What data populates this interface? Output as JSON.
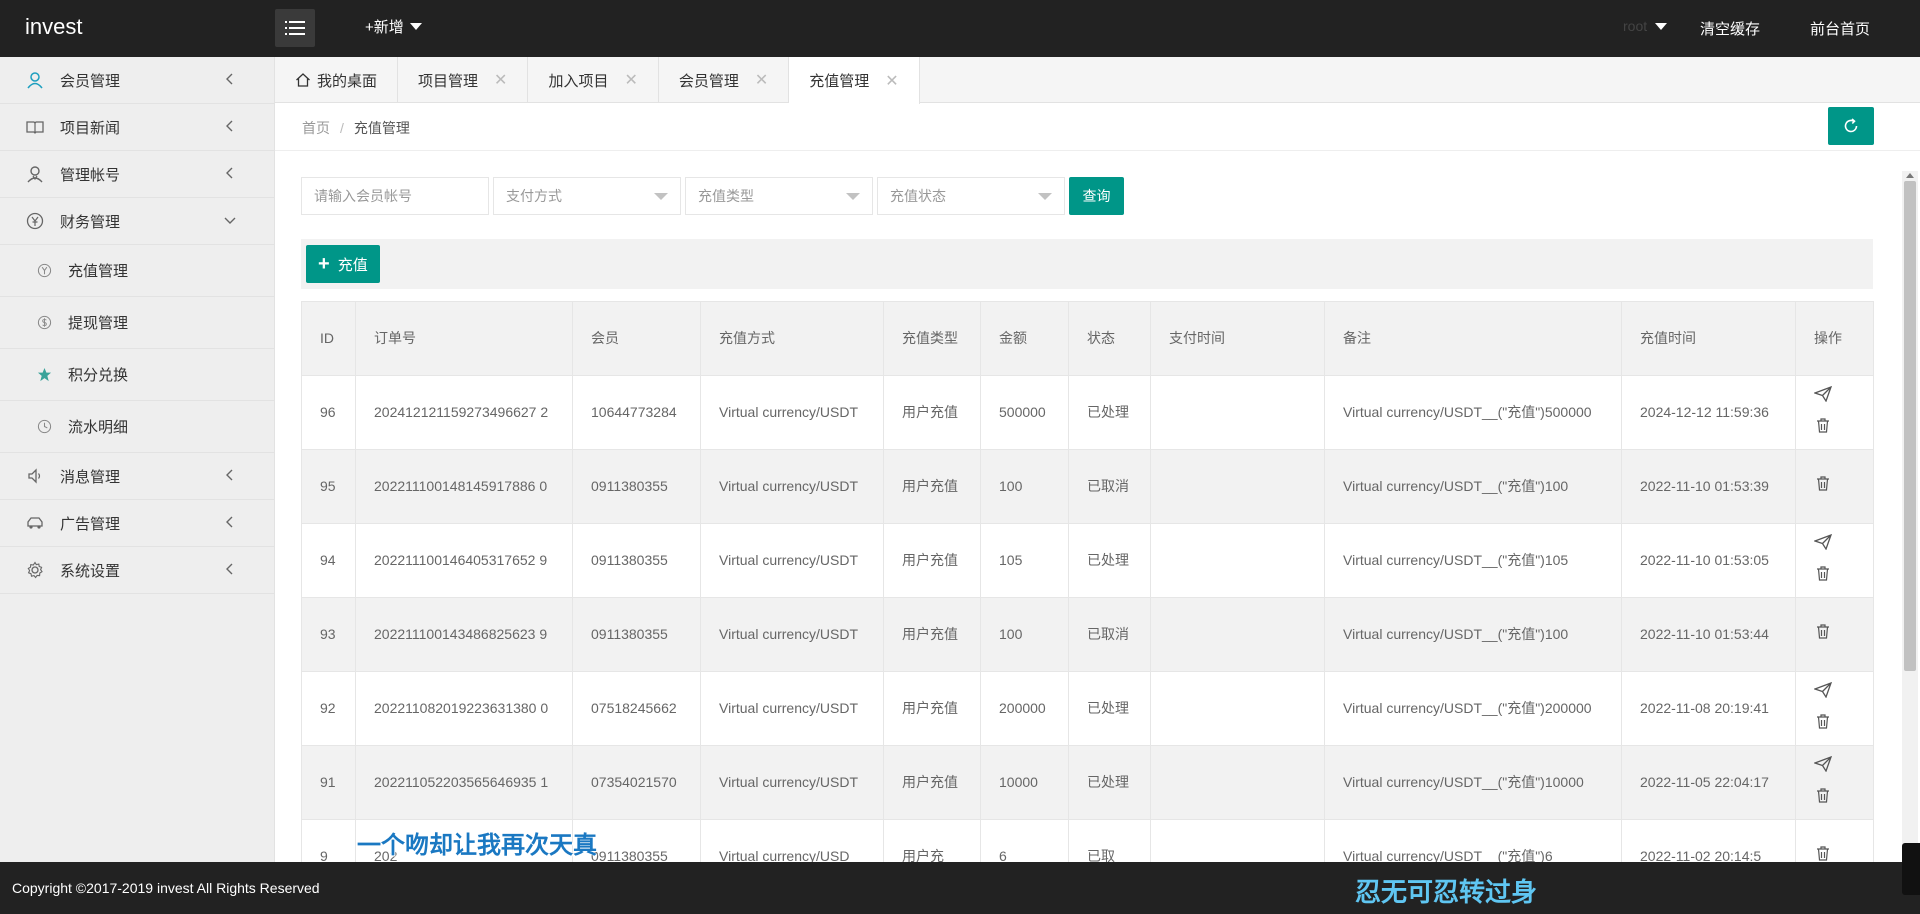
{
  "header": {
    "logo": "invest",
    "add_new": "+新增",
    "user": "root",
    "clear_cache": "清空缓存",
    "front_home": "前台首页"
  },
  "sidebar": {
    "items": [
      {
        "label": "会员管理",
        "icon": "user-icon"
      },
      {
        "label": "项目新闻",
        "icon": "book-icon"
      },
      {
        "label": "管理帐号",
        "icon": "admin-icon"
      },
      {
        "label": "财务管理",
        "icon": "yen-icon"
      },
      {
        "label": "消息管理",
        "icon": "speaker-icon"
      },
      {
        "label": "广告管理",
        "icon": "car-icon"
      },
      {
        "label": "系统设置",
        "icon": "gear-icon"
      }
    ],
    "finance_sub": [
      {
        "label": "充值管理",
        "icon": "yen-circle-icon"
      },
      {
        "label": "提现管理",
        "icon": "dollar-circle-icon"
      },
      {
        "label": "积分兑换",
        "icon": "star-icon"
      },
      {
        "label": "流水明细",
        "icon": "clock-icon"
      }
    ]
  },
  "tabs": [
    {
      "label": "我的桌面"
    },
    {
      "label": "项目管理"
    },
    {
      "label": "加入项目"
    },
    {
      "label": "会员管理"
    },
    {
      "label": "充值管理"
    }
  ],
  "breadcrumb": {
    "home": "首页",
    "sep": "/",
    "current": "充值管理"
  },
  "filter": {
    "member_placeholder": "请输入会员帐号",
    "pay_method": "支付方式",
    "recharge_type": "充值类型",
    "recharge_status": "充值状态",
    "query": "查询"
  },
  "toolbar": {
    "recharge": "充值"
  },
  "table": {
    "headers": [
      "ID",
      "订单号",
      "会员",
      "充值方式",
      "充值类型",
      "金额",
      "状态",
      "支付时间",
      "备注",
      "充值时间",
      "操作"
    ],
    "rows": [
      {
        "id": "96",
        "order": "202412121159273496627 2",
        "member": "10644773284",
        "method": "Virtual currency/USDT",
        "type": "用户充值",
        "amount": "500000",
        "status": "已处理",
        "pay_time": "",
        "note": "Virtual currency/USDT__(\"充值\")500000",
        "time": "2024-12-12 11:59:36",
        "ops": [
          "send",
          "delete"
        ]
      },
      {
        "id": "95",
        "order": "202211100148145917886 0",
        "member": "0911380355",
        "method": "Virtual currency/USDT",
        "type": "用户充值",
        "amount": "100",
        "status": "已取消",
        "pay_time": "",
        "note": "Virtual currency/USDT__(\"充值\")100",
        "time": "2022-11-10 01:53:39",
        "ops": [
          "delete"
        ]
      },
      {
        "id": "94",
        "order": "202211100146405317652 9",
        "member": "0911380355",
        "method": "Virtual currency/USDT",
        "type": "用户充值",
        "amount": "105",
        "status": "已处理",
        "pay_time": "",
        "note": "Virtual currency/USDT__(\"充值\")105",
        "time": "2022-11-10 01:53:05",
        "ops": [
          "send",
          "delete"
        ]
      },
      {
        "id": "93",
        "order": "202211100143486825623 9",
        "member": "0911380355",
        "method": "Virtual currency/USDT",
        "type": "用户充值",
        "amount": "100",
        "status": "已取消",
        "pay_time": "",
        "note": "Virtual currency/USDT__(\"充值\")100",
        "time": "2022-11-10 01:53:44",
        "ops": [
          "delete"
        ]
      },
      {
        "id": "92",
        "order": "202211082019223631380 0",
        "member": "07518245662",
        "method": "Virtual currency/USDT",
        "type": "用户充值",
        "amount": "200000",
        "status": "已处理",
        "pay_time": "",
        "note": "Virtual currency/USDT__(\"充值\")200000",
        "time": "2022-11-08 20:19:41",
        "ops": [
          "send",
          "delete"
        ]
      },
      {
        "id": "91",
        "order": "202211052203565646935 1",
        "member": "07354021570",
        "method": "Virtual currency/USDT",
        "type": "用户充值",
        "amount": "10000",
        "status": "已处理",
        "pay_time": "",
        "note": "Virtual currency/USDT__(\"充值\")10000",
        "time": "2022-11-05 22:04:17",
        "ops": [
          "send",
          "delete"
        ]
      },
      {
        "id": "9",
        "order": "202",
        "member": "0911380355",
        "method": "Virtual currency/USD",
        "type": "用户充",
        "amount": "6",
        "status": "已取",
        "pay_time": "",
        "note": "Virtual currency/USDT__(\"充值\")6",
        "time": "2022-11-02 20:14:5",
        "ops": [
          "delete"
        ]
      }
    ]
  },
  "overlay_subtitle": "一个吻却让我再次天真",
  "footer": {
    "copyright": "Copyright ©2017-2019 invest All Rights Reserved",
    "lyric": "忍无可忍转过身"
  },
  "colors": {
    "accent": "#009688",
    "header_bg": "#222222",
    "subtitle": "#1a78c2",
    "lyric": "#5fc6f2"
  }
}
